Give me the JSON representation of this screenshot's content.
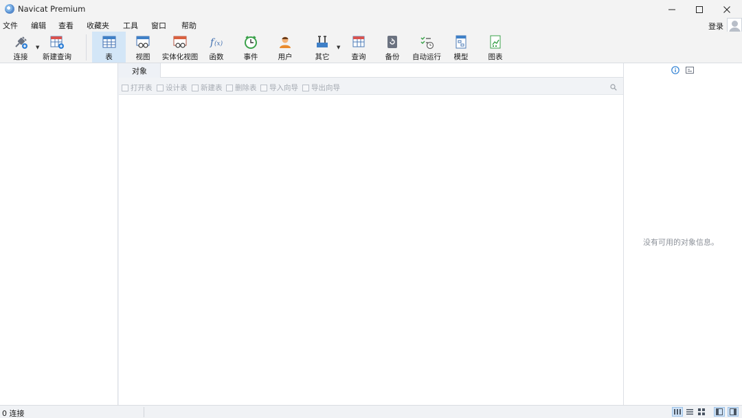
{
  "window": {
    "title": "Navicat Premium",
    "login_label": "登录"
  },
  "menu": [
    "文件",
    "编辑",
    "查看",
    "收藏夹",
    "工具",
    "窗口",
    "帮助"
  ],
  "toolbar": {
    "connect": "连接",
    "new_query": "新建查询",
    "table": "表",
    "view": "视图",
    "materialized_view": "实体化视图",
    "function": "函数",
    "event": "事件",
    "user": "用户",
    "others": "其它",
    "query": "查询",
    "backup": "备份",
    "automation": "自动运行",
    "model": "模型",
    "chart": "图表",
    "active_tool": "表"
  },
  "objects_tab": {
    "label": "对象"
  },
  "object_actions": {
    "open_table": "打开表",
    "design_table": "设计表",
    "new_table": "新建表",
    "delete_table": "删除表",
    "import_wizard": "导入向导",
    "export_wizard": "导出向导"
  },
  "info_pane": {
    "empty_message": "没有可用的对象信息。"
  },
  "status": {
    "connections": "0 连接"
  },
  "colors": {
    "accent": "#d3e6f7",
    "chrome": "#f3f3f3",
    "info_blue": "#2d7fd3"
  }
}
